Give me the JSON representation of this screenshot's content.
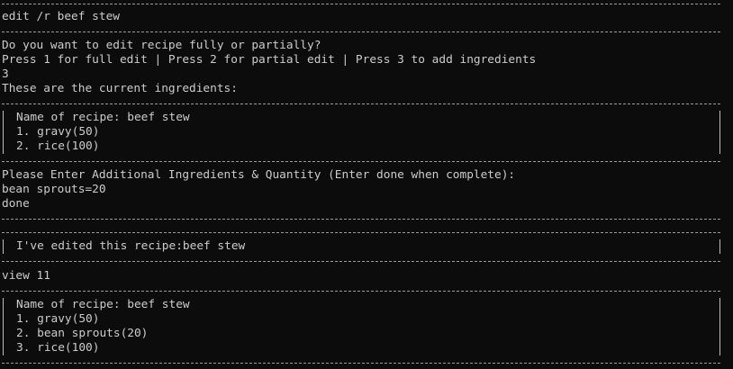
{
  "lines": {
    "cmd_edit": "edit /r beef stew",
    "prompt_mode": "Do you want to edit recipe fully or partially?",
    "mode_options": "Press 1 for full edit | Press 2 for partial edit | Press 3 to add ingredients",
    "input_mode": "3",
    "current_heading": "These are the current ingredients:",
    "box1_name": "Name of recipe: beef stew",
    "box1_item1": "1. gravy(50)",
    "box1_item2": "2. rice(100)",
    "prompt_additional": "Please Enter Additional Ingredients & Quantity (Enter done when complete):",
    "input_ingredient": "bean sprouts=20",
    "input_done": "done",
    "confirm_msg": "I've edited this recipe:beef stew",
    "cmd_view": "view 11",
    "box2_name": "Name of recipe: beef stew",
    "box2_item1": "1. gravy(50)",
    "box2_item2": "2. bean sprouts(20)",
    "box2_item3": "3. rice(100)"
  }
}
